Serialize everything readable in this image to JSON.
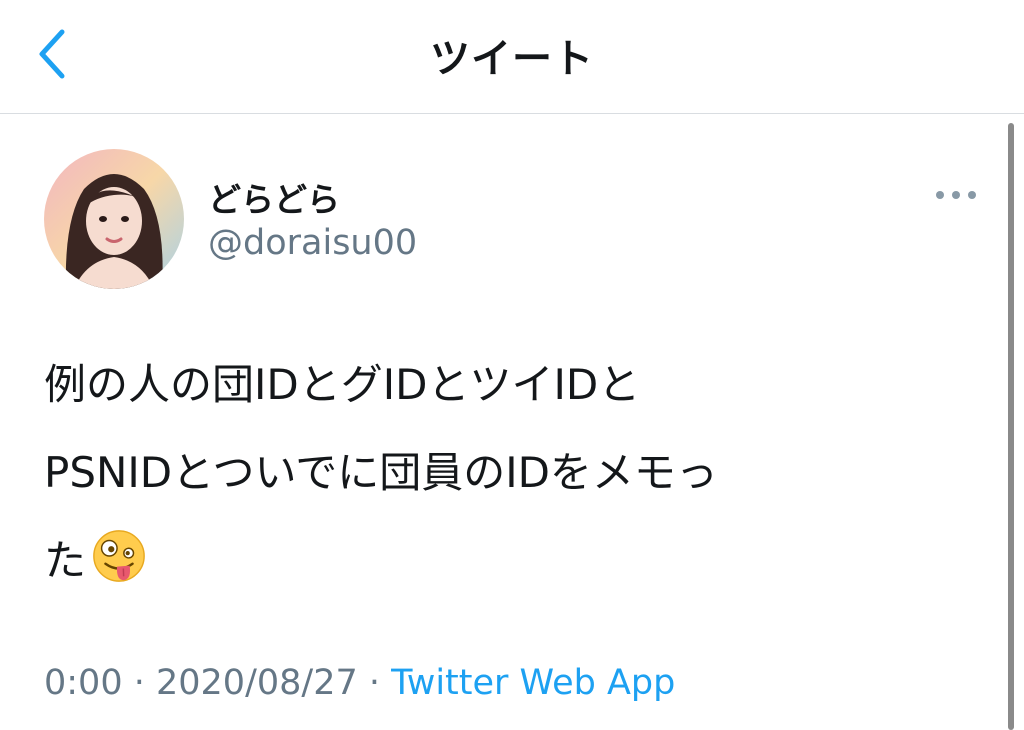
{
  "header": {
    "title": "ツイート",
    "back_icon": "chevron-left-icon",
    "accent_color": "#1da1f2"
  },
  "tweet": {
    "display_name": "どらどら",
    "handle": "@doraisu00",
    "text_line1": "例の人の団IDとグIDとツイIDと",
    "text_line2": "PSNIDとついでに団員のIDをメモっ",
    "text_line3": "た",
    "emoji": "zany-face-emoji",
    "time": "0:00",
    "separator": " · ",
    "date": "2020/08/27",
    "source": "Twitter Web App",
    "more_icon": "more-dots-icon",
    "avatar": "user-avatar"
  }
}
